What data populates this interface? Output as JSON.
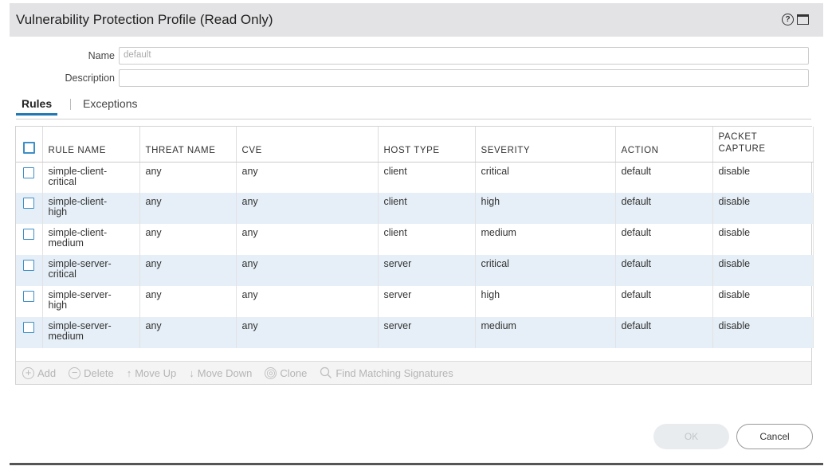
{
  "dialog": {
    "title": "Vulnerability Protection Profile (Read Only)",
    "help_icon_glyph": "?",
    "name_label": "Name",
    "name_value": "default",
    "description_label": "Description",
    "description_value": ""
  },
  "tabs": {
    "rules": "Rules",
    "exceptions": "Exceptions"
  },
  "table": {
    "headers": {
      "rule_name": "RULE NAME",
      "threat_name": "THREAT NAME",
      "cve": "CVE",
      "host_type": "HOST TYPE",
      "severity": "SEVERITY",
      "action": "ACTION",
      "packet_capture_1": "PACKET",
      "packet_capture_2": "CAPTURE"
    },
    "rows": [
      {
        "rule1": "simple-client-",
        "rule2": "critical",
        "threat": "any",
        "cve": "any",
        "host": "client",
        "severity": "critical",
        "action": "default",
        "capture": "disable"
      },
      {
        "rule1": "simple-client-",
        "rule2": "high",
        "threat": "any",
        "cve": "any",
        "host": "client",
        "severity": "high",
        "action": "default",
        "capture": "disable"
      },
      {
        "rule1": "simple-client-",
        "rule2": "medium",
        "threat": "any",
        "cve": "any",
        "host": "client",
        "severity": "medium",
        "action": "default",
        "capture": "disable"
      },
      {
        "rule1": "simple-server-",
        "rule2": "critical",
        "threat": "any",
        "cve": "any",
        "host": "server",
        "severity": "critical",
        "action": "default",
        "capture": "disable"
      },
      {
        "rule1": "simple-server-",
        "rule2": "high",
        "threat": "any",
        "cve": "any",
        "host": "server",
        "severity": "high",
        "action": "default",
        "capture": "disable"
      },
      {
        "rule1": "simple-server-",
        "rule2": "medium",
        "threat": "any",
        "cve": "any",
        "host": "server",
        "severity": "medium",
        "action": "default",
        "capture": "disable"
      }
    ]
  },
  "toolbar": {
    "add": "Add",
    "delete": "Delete",
    "move_up": "Move Up",
    "move_down": "Move Down",
    "clone": "Clone",
    "find": "Find Matching Signatures"
  },
  "buttons": {
    "ok": "OK",
    "cancel": "Cancel"
  },
  "colors": {
    "accent": "#1f78b4",
    "row_alt": "#e6eff7",
    "title_bar": "#e3e3e5"
  }
}
